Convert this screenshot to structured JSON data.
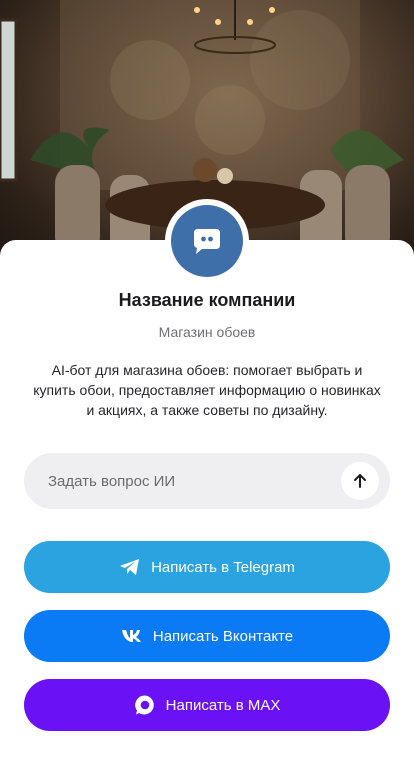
{
  "company": {
    "name": "Название компании",
    "subtitle": "Магазин обоев",
    "description": "AI-бот для магазина обоев: помогает выбрать и купить обои, предоставляет информацию о новинках и акциях, а также советы по дизайну."
  },
  "avatar": {
    "icon": "chat-bot-icon"
  },
  "ask": {
    "placeholder": "Задать вопрос ИИ",
    "send_icon": "arrow-up-icon"
  },
  "buttons": [
    {
      "label": "Написать в Telegram",
      "icon": "telegram-icon",
      "color": "#2aa3e0"
    },
    {
      "label": "Написать Вконтакте",
      "icon": "vk-icon",
      "color": "#0a7bf4"
    },
    {
      "label": "Написать в MAX",
      "icon": "max-icon",
      "color": "#6a11f5"
    }
  ]
}
